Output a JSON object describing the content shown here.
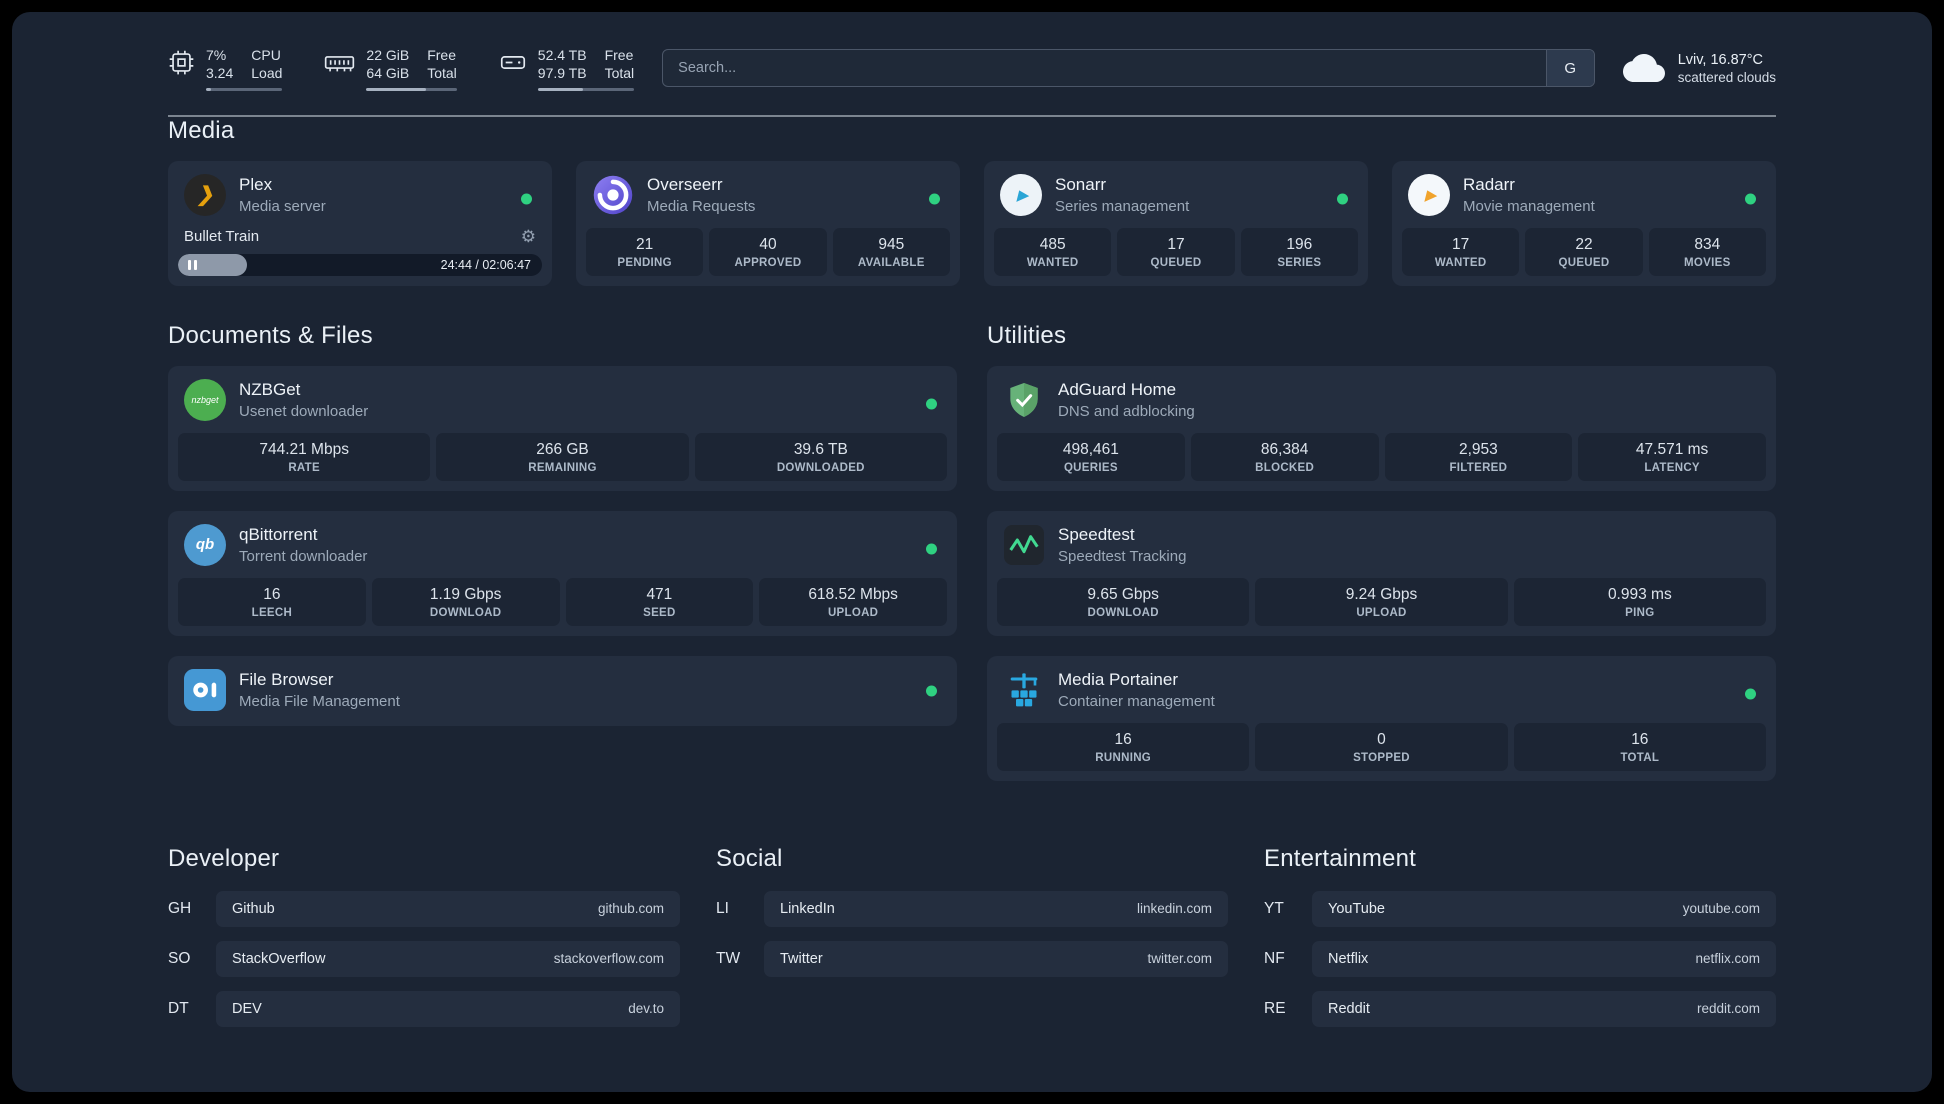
{
  "colors": {
    "status_green": "#2fd181",
    "plex_amber": "#e5a00d",
    "overseerr_purple": "#6f5ff0",
    "sonarr_blue": "#2aa5d6",
    "radarr_gold": "#f0a32c",
    "nzbget_green": "#4cae50",
    "qbittorrent_blue": "#4e9ad0",
    "filebrowser_blue": "#4598d4",
    "adguard_green": "#67b279",
    "speedtest_green": "#41d991",
    "portainer_blue": "#29a8e0"
  },
  "icons": {
    "plex_glyph": "❯",
    "sonarr_glyph": "▶",
    "radarr_glyph": "▶",
    "gear_glyph": "⚙",
    "nzbget_label": "nzbget",
    "qbittorrent_label": "qb"
  },
  "header": {
    "resources": [
      {
        "value_top": "7%",
        "value_bottom": "3.24",
        "label_top": "CPU",
        "label_bottom": "Load",
        "bar_pct": 7
      },
      {
        "value_top": "22 GiB",
        "value_bottom": "64 GiB",
        "label_top": "Free",
        "label_bottom": "Total",
        "bar_pct": 66
      },
      {
        "value_top": "52.4 TB",
        "value_bottom": "97.9 TB",
        "label_top": "Free",
        "label_bottom": "Total",
        "bar_pct": 47
      }
    ],
    "search": {
      "placeholder": "Search...",
      "provider": "G"
    },
    "weather": {
      "location": "Lviv, 16.87°C",
      "condition": "scattered clouds"
    }
  },
  "sections": {
    "media": {
      "title": "Media",
      "plex": {
        "name": "Plex",
        "desc": "Media server",
        "now_playing": "Bullet Train",
        "time": "24:44 / 02:06:47",
        "progress_pct": 19
      },
      "overseerr": {
        "name": "Overseerr",
        "desc": "Media Requests",
        "stats": [
          {
            "value": "21",
            "label": "PENDING"
          },
          {
            "value": "40",
            "label": "APPROVED"
          },
          {
            "value": "945",
            "label": "AVAILABLE"
          }
        ]
      },
      "sonarr": {
        "name": "Sonarr",
        "desc": "Series management",
        "stats": [
          {
            "value": "485",
            "label": "WANTED"
          },
          {
            "value": "17",
            "label": "QUEUED"
          },
          {
            "value": "196",
            "label": "SERIES"
          }
        ]
      },
      "radarr": {
        "name": "Radarr",
        "desc": "Movie management",
        "stats": [
          {
            "value": "17",
            "label": "WANTED"
          },
          {
            "value": "22",
            "label": "QUEUED"
          },
          {
            "value": "834",
            "label": "MOVIES"
          }
        ]
      }
    },
    "documents": {
      "title": "Documents & Files",
      "nzbget": {
        "name": "NZBGet",
        "desc": "Usenet downloader",
        "stats": [
          {
            "value": "744.21 Mbps",
            "label": "RATE"
          },
          {
            "value": "266 GB",
            "label": "REMAINING"
          },
          {
            "value": "39.6 TB",
            "label": "DOWNLOADED"
          }
        ]
      },
      "qbittorrent": {
        "name": "qBittorrent",
        "desc": "Torrent downloader",
        "stats": [
          {
            "value": "16",
            "label": "LEECH"
          },
          {
            "value": "1.19 Gbps",
            "label": "DOWNLOAD"
          },
          {
            "value": "471",
            "label": "SEED"
          },
          {
            "value": "618.52 Mbps",
            "label": "UPLOAD"
          }
        ]
      },
      "filebrowser": {
        "name": "File Browser",
        "desc": "Media File Management"
      }
    },
    "utilities": {
      "title": "Utilities",
      "adguard": {
        "name": "AdGuard Home",
        "desc": "DNS and adblocking",
        "stats": [
          {
            "value": "498,461",
            "label": "QUERIES"
          },
          {
            "value": "86,384",
            "label": "BLOCKED"
          },
          {
            "value": "2,953",
            "label": "FILTERED"
          },
          {
            "value": "47.571 ms",
            "label": "LATENCY"
          }
        ]
      },
      "speedtest": {
        "name": "Speedtest",
        "desc": "Speedtest Tracking",
        "stats": [
          {
            "value": "9.65 Gbps",
            "label": "DOWNLOAD"
          },
          {
            "value": "9.24 Gbps",
            "label": "UPLOAD"
          },
          {
            "value": "0.993 ms",
            "label": "PING"
          }
        ]
      },
      "portainer": {
        "name": "Media Portainer",
        "desc": "Container management",
        "stats": [
          {
            "value": "16",
            "label": "RUNNING"
          },
          {
            "value": "0",
            "label": "STOPPED"
          },
          {
            "value": "16",
            "label": "TOTAL"
          }
        ]
      }
    }
  },
  "bookmarks": {
    "developer": {
      "title": "Developer",
      "items": [
        {
          "abbr": "GH",
          "name": "Github",
          "domain": "github.com"
        },
        {
          "abbr": "SO",
          "name": "StackOverflow",
          "domain": "stackoverflow.com"
        },
        {
          "abbr": "DT",
          "name": "DEV",
          "domain": "dev.to"
        }
      ]
    },
    "social": {
      "title": "Social",
      "items": [
        {
          "abbr": "LI",
          "name": "LinkedIn",
          "domain": "linkedin.com"
        },
        {
          "abbr": "TW",
          "name": "Twitter",
          "domain": "twitter.com"
        }
      ]
    },
    "entertainment": {
      "title": "Entertainment",
      "items": [
        {
          "abbr": "YT",
          "name": "YouTube",
          "domain": "youtube.com"
        },
        {
          "abbr": "NF",
          "name": "Netflix",
          "domain": "netflix.com"
        },
        {
          "abbr": "RE",
          "name": "Reddit",
          "domain": "reddit.com"
        }
      ]
    }
  }
}
